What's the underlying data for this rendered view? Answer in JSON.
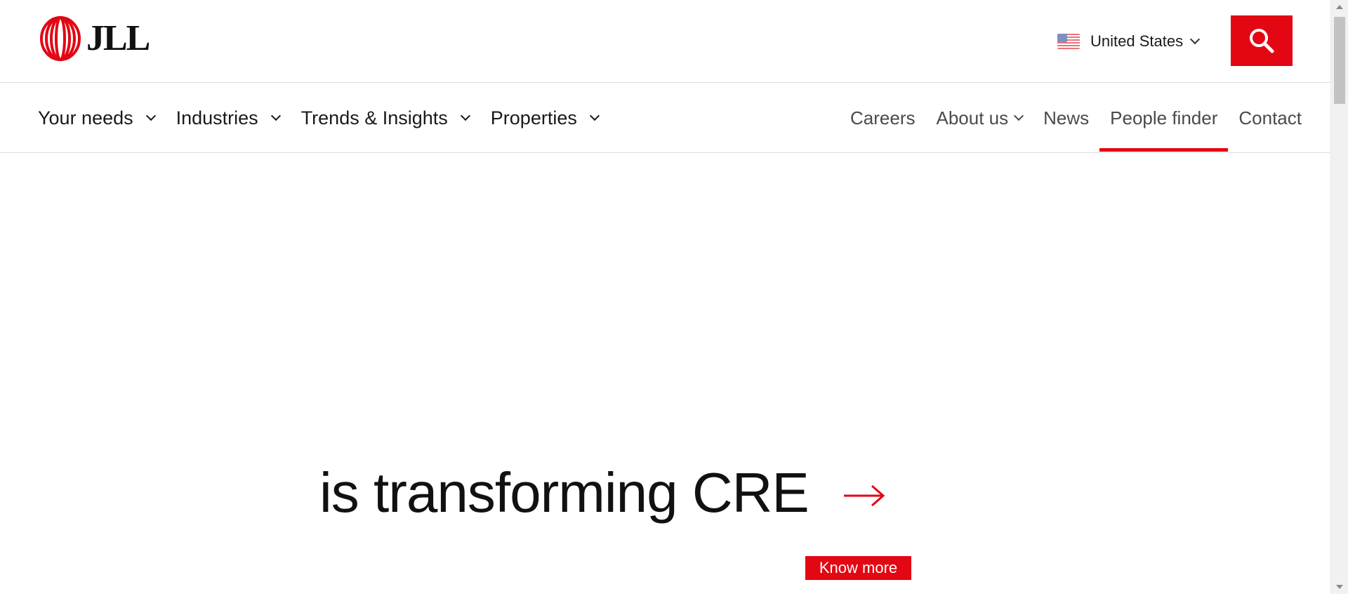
{
  "brand": {
    "name": "JLL",
    "accent_color": "#e30613"
  },
  "header": {
    "country": {
      "flag_icon": "us-flag-icon",
      "label": "United States"
    },
    "search": {
      "icon": "search-icon"
    }
  },
  "main_nav": [
    {
      "label": "Your needs"
    },
    {
      "label": "Industries"
    },
    {
      "label": "Trends & Insights"
    },
    {
      "label": "Properties"
    }
  ],
  "secondary_nav": {
    "careers": "Careers",
    "about": "About us",
    "news": "News",
    "people_finder": "People finder",
    "contact": "Contact",
    "active": "People finder"
  },
  "hero": {
    "headline": "is transforming CRE",
    "cta": "Know more"
  }
}
